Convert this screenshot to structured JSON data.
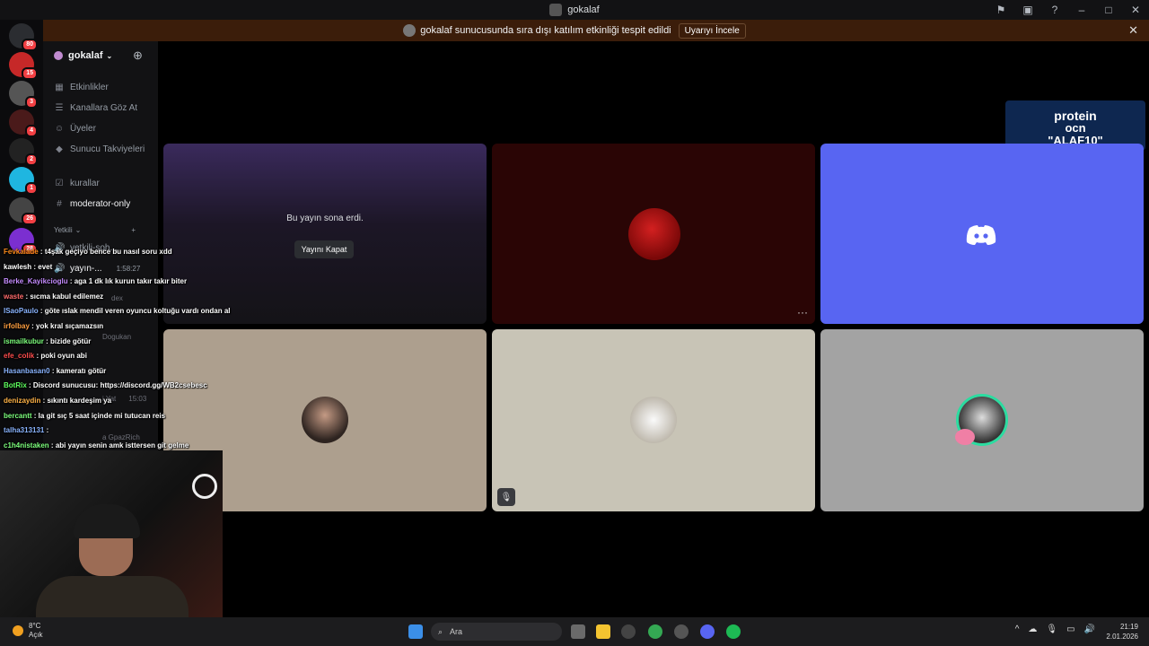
{
  "window": {
    "title": "gokalaf"
  },
  "banner": {
    "text": "gokalaf sunucusunda sıra dışı katılım etkinliği tespit edildi",
    "button": "Uyarıyı İncele"
  },
  "guilds": [
    {
      "badge": "80",
      "color": "#2b2d31",
      "icon": "discord-home-icon"
    },
    {
      "badge": "15",
      "color": "#c62828",
      "icon": "gmail-server-icon"
    },
    {
      "badge": "3",
      "color": "#555555",
      "icon": "server-icon"
    },
    {
      "badge": "4",
      "color": "#4a1a1a",
      "icon": "server-icon"
    },
    {
      "badge": "2",
      "color": "#222222",
      "icon": "eye-server-icon"
    },
    {
      "badge": "1",
      "color": "#1fb6e0",
      "icon": "server-icon"
    },
    {
      "badge": "26",
      "color": "#444444",
      "icon": "server-icon"
    },
    {
      "badge": "28",
      "color": "#7b2fd0",
      "icon": "wifi-server-icon"
    }
  ],
  "server": {
    "name": "gokalaf"
  },
  "channels": {
    "top": [
      {
        "label": "Etkinlikler",
        "icon": "calendar-icon"
      },
      {
        "label": "Kanallara Göz At",
        "icon": "browse-icon"
      },
      {
        "label": "Üyeler",
        "icon": "members-icon"
      },
      {
        "label": "Sunucu Takviyeleri",
        "icon": "boost-icon"
      }
    ],
    "kurallar": "kurallar",
    "moderator": "moderator-only",
    "category": "Yetkili",
    "voice_channel": "yetkili-soh...",
    "stream_channel": "yayın-...",
    "stream_time": "1:58:27",
    "users": [
      "dex",
      "Dogukan",
      "i Yat",
      "a GpazRich"
    ],
    "voice_time": "15:03"
  },
  "stage": {
    "ended_text": "Bu yayın sona erdi.",
    "close_button": "Yayını Kapat",
    "more": "···"
  },
  "promo": {
    "line1": "protein",
    "line2": "ocn",
    "line3": "\"ALAF10\""
  },
  "chat": [
    {
      "user": "Fevkalade",
      "color": "#ff8c1a",
      "msg": "t4şak geçiyo bence bu nasıl soru xdd"
    },
    {
      "user": "kawlesh",
      "color": "#ffffff",
      "msg": "evet"
    },
    {
      "user": "Berke_Kayikcioglu",
      "color": "#c58cff",
      "msg": "aga 1 dk lık kurun takır takır biter"
    },
    {
      "user": "waste",
      "color": "#ff6b6b",
      "msg": "sıcma kabul edilemez"
    },
    {
      "user": "ISaoPaulo",
      "color": "#8ab4ff",
      "msg": "göte ıslak mendil veren oyuncu koltuğu vardı ondan al"
    },
    {
      "user": "irfolbay",
      "color": "#ff9f40",
      "msg": "yok kral sıçamazsın"
    },
    {
      "user": "ismailkubur",
      "color": "#7dff7d",
      "msg": "bizide götür"
    },
    {
      "user": "efe_colik",
      "color": "#ff4d4d",
      "msg": "poki oyun abi"
    },
    {
      "user": "Hasanbasan0",
      "color": "#8ab4ff",
      "msg": "kameratı götür"
    },
    {
      "user": "BotRix",
      "color": "#5fff5f",
      "msg": "Discord sunucusu: https://discord.gg/WB2csebesc"
    },
    {
      "user": "denizaydin",
      "color": "#ffb347",
      "msg": "sıkıntı kardeşim ya"
    },
    {
      "user": "bercantt",
      "color": "#7dff7d",
      "msg": "la git sıç 5 saat içinde mi tutucan reis"
    },
    {
      "user": "talha313131",
      "color": "#8ab4ff",
      "msg": ""
    },
    {
      "user": "c1h4nistaken",
      "color": "#7dff7d",
      "msg": "abi yayın senin amk isttersen git gelme"
    }
  ],
  "taskbar": {
    "weather_temp": "8°C",
    "weather_desc": "Açık",
    "search": "Ara",
    "time": "21:19",
    "date": "2.01.2026"
  }
}
